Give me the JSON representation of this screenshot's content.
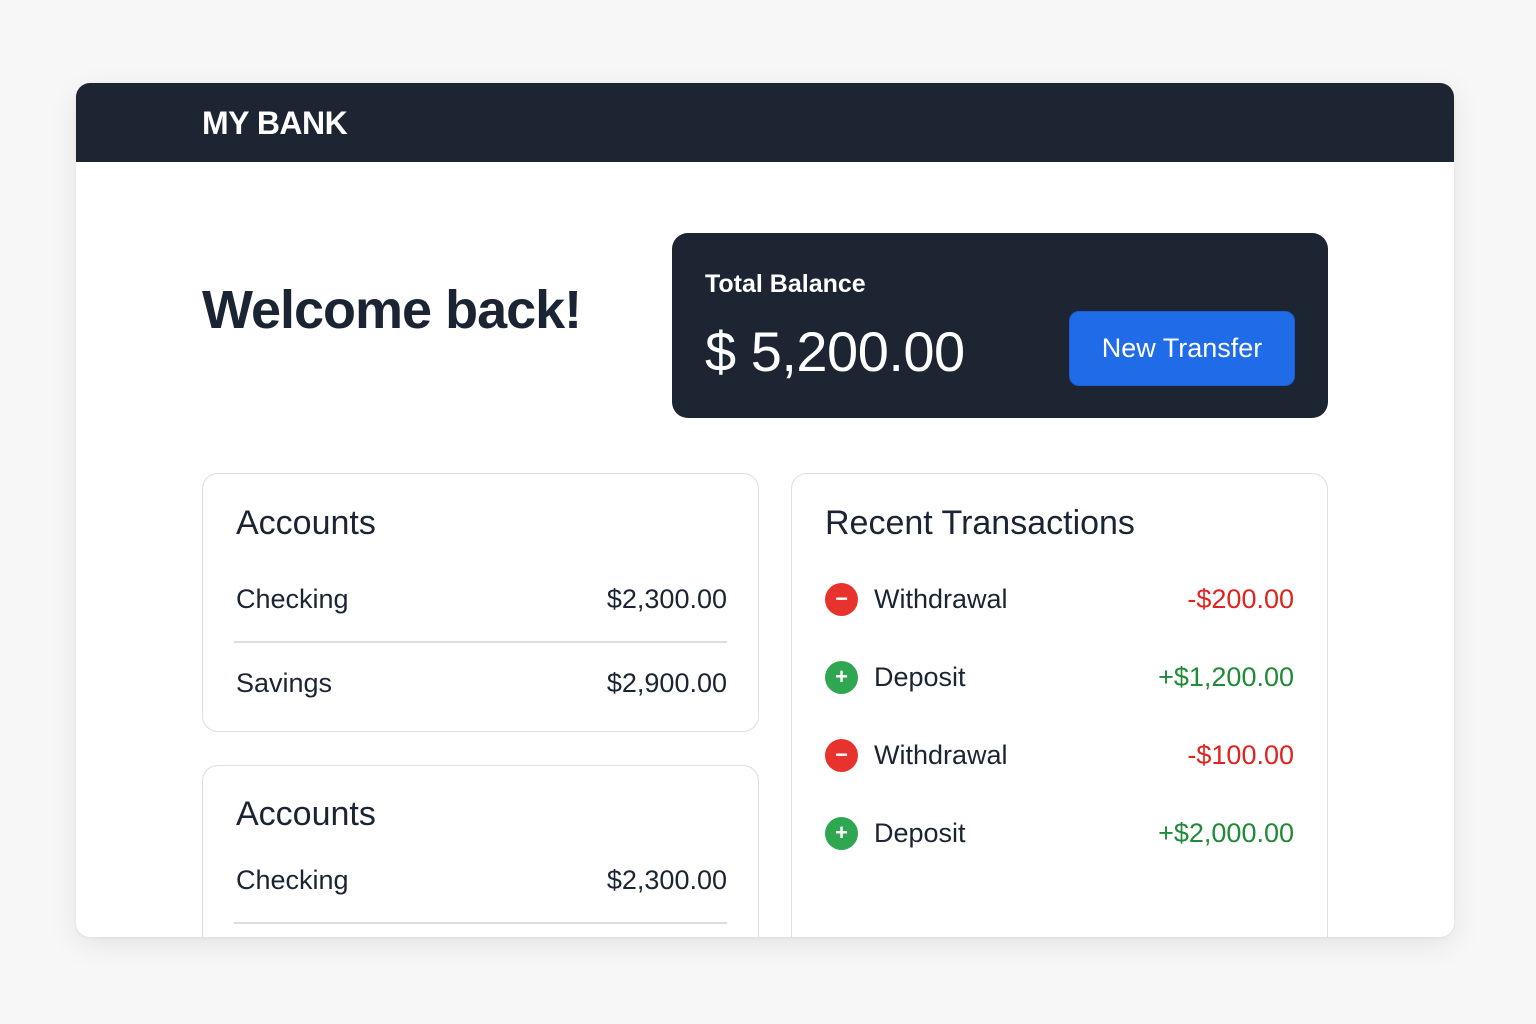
{
  "navbar": {
    "brand": "MY BANK"
  },
  "welcome": {
    "heading": "Welcome back!"
  },
  "balance": {
    "label": "Total Balance",
    "amount": "$ 5,200.00",
    "transfer_button": "New Transfer"
  },
  "accounts": {
    "title": "Accounts",
    "items": [
      {
        "name": "Checking",
        "amount": "$2,300.00"
      },
      {
        "name": "Savings",
        "amount": "$2,900.00"
      }
    ]
  },
  "accounts_secondary": {
    "title": "Accounts",
    "items": [
      {
        "name": "Checking",
        "amount": "$2,300.00"
      }
    ]
  },
  "transactions": {
    "title": "Recent Transactions",
    "items": [
      {
        "type": "Withdrawal",
        "amount": "-$200.00",
        "icon": "minus-icon",
        "icon_glyph": "−",
        "color": "#e0231f"
      },
      {
        "type": "Deposit",
        "amount": "+$1,200.00",
        "icon": "plus-icon",
        "icon_glyph": "+",
        "color": "#1f8a37"
      },
      {
        "type": "Withdrawal",
        "amount": "-$100.00",
        "icon": "minus-icon",
        "icon_glyph": "−",
        "color": "#e0231f"
      },
      {
        "type": "Deposit",
        "amount": "+$2,000.00",
        "icon": "plus-icon",
        "icon_glyph": "+",
        "color": "#1f8a37"
      }
    ]
  },
  "colors": {
    "navbar": "#1d2533",
    "accent": "#1f6be8",
    "negative": "#e0231f",
    "positive": "#1f8a37"
  }
}
